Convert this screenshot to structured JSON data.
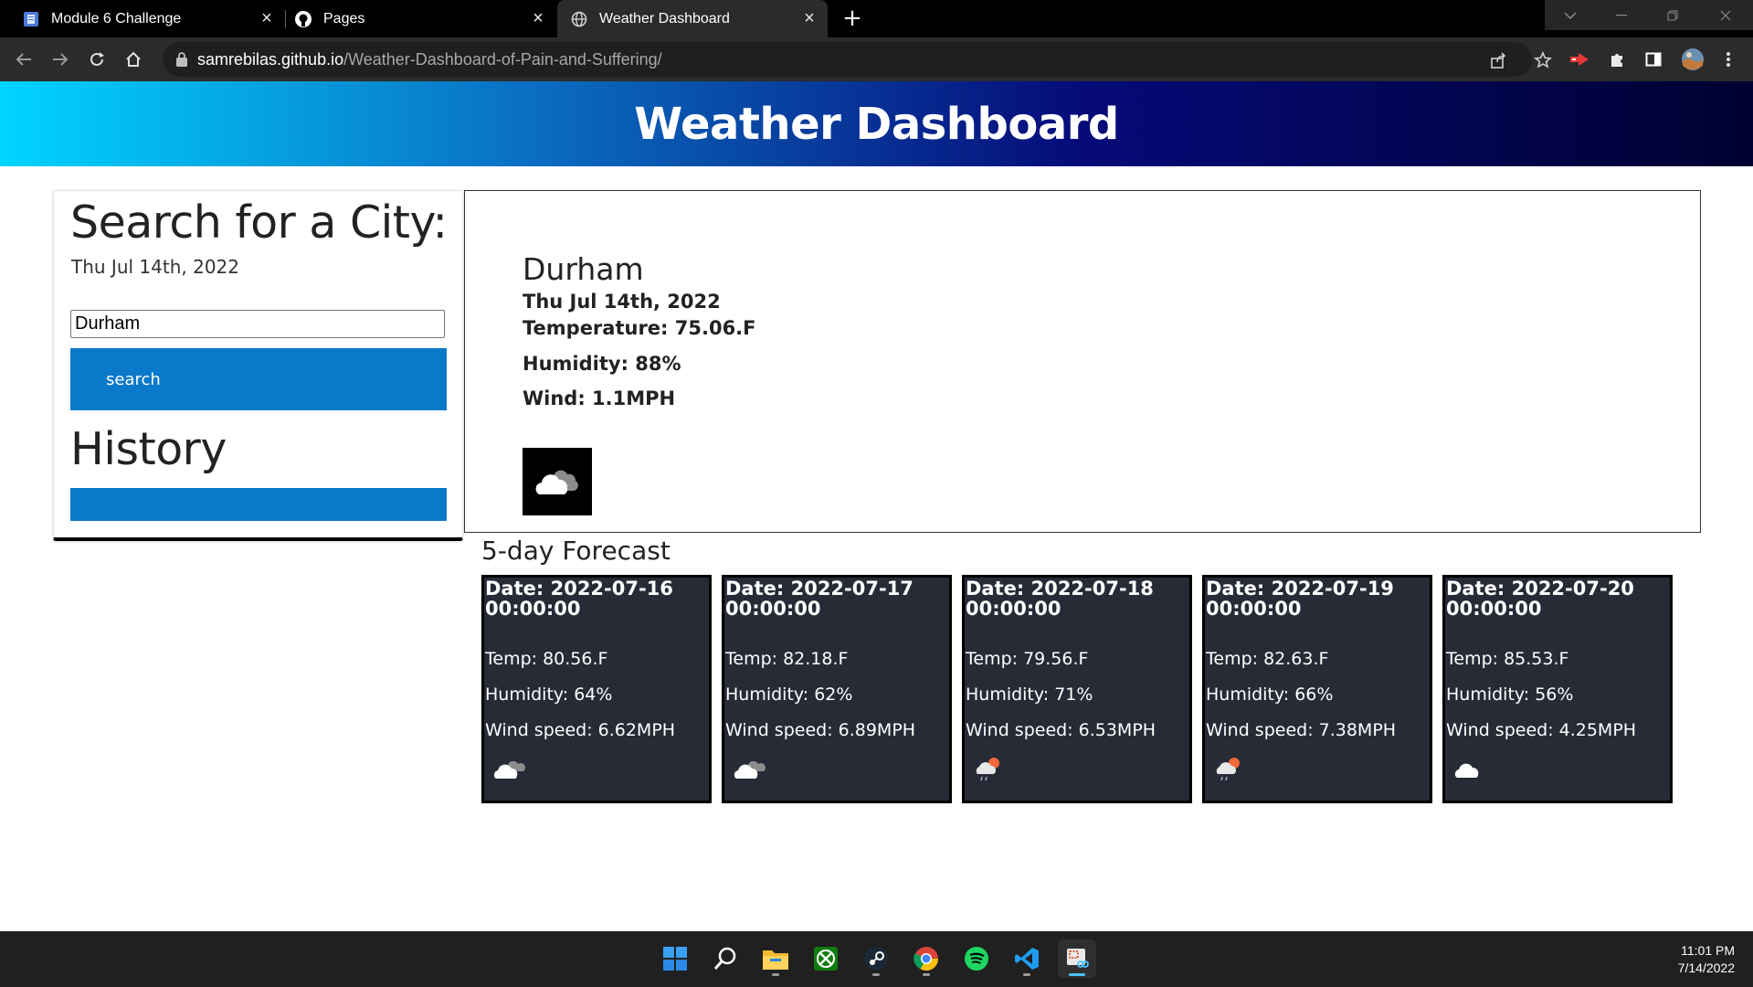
{
  "browser": {
    "tabs": [
      {
        "title": "Module 6 Challenge",
        "icon": "document-icon",
        "active": false
      },
      {
        "title": "Pages",
        "icon": "github-icon",
        "active": false
      },
      {
        "title": "Weather Dashboard",
        "icon": "globe-icon",
        "active": true
      }
    ],
    "url_domain": "samrebilas.github.io",
    "url_path": "/Weather-Dashboard-of-Pain-and-Suffering/"
  },
  "page": {
    "header_title": "Weather Dashboard",
    "search": {
      "heading": "Search for a City:",
      "today": "Thu Jul 14th, 2022",
      "input_value": "Durham",
      "button_label": "search",
      "history_heading": "History"
    },
    "current": {
      "city": "Durham",
      "date": "Thu Jul 14th, 2022",
      "temperature": "Temperature: 75.06.F",
      "humidity": "Humidity: 88%",
      "wind": "Wind: 1.1MPH",
      "icon": "cloudy-icon"
    },
    "forecast_title": "5-day Forecast",
    "forecast": [
      {
        "date": "Date: 2022-07-16 00:00:00",
        "temp": "Temp: 80.56.F",
        "humidity": "Humidity: 64%",
        "wind": "Wind speed: 6.62MPH",
        "icon": "cloudy-icon"
      },
      {
        "date": "Date: 2022-07-17 00:00:00",
        "temp": "Temp: 82.18.F",
        "humidity": "Humidity: 62%",
        "wind": "Wind speed: 6.89MPH",
        "icon": "cloudy-icon"
      },
      {
        "date": "Date: 2022-07-18 00:00:00",
        "temp": "Temp: 79.56.F",
        "humidity": "Humidity: 71%",
        "wind": "Wind speed: 6.53MPH",
        "icon": "rain-sun-icon"
      },
      {
        "date": "Date: 2022-07-19 00:00:00",
        "temp": "Temp: 82.63.F",
        "humidity": "Humidity: 66%",
        "wind": "Wind speed: 7.38MPH",
        "icon": "rain-sun-icon"
      },
      {
        "date": "Date: 2022-07-20 00:00:00",
        "temp": "Temp: 85.53.F",
        "humidity": "Humidity: 56%",
        "wind": "Wind speed: 4.25MPH",
        "icon": "cloud-icon"
      }
    ]
  },
  "taskbar": {
    "apps": [
      "windows-start-icon",
      "search-icon",
      "file-explorer-icon",
      "xbox-icon",
      "steam-icon",
      "chrome-icon",
      "spotify-icon",
      "vscode-icon",
      "snipping-tool-icon"
    ],
    "time": "11:01 PM",
    "date": "7/14/2022"
  },
  "colors": {
    "accent_blue": "#0b79c9",
    "card_bg": "#262b36",
    "header_gradient_start": "#00d4ff",
    "header_gradient_end": "#000030"
  }
}
